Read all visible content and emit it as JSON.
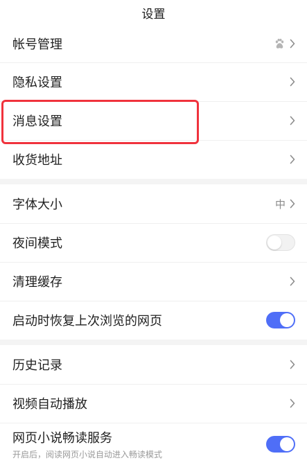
{
  "header": {
    "title": "设置"
  },
  "colors": {
    "accent": "#4f6ef7",
    "highlight": "#f0323c",
    "divider": "#efefef",
    "section_gap": "#f4f4f4"
  },
  "group1": {
    "account": {
      "label": "帐号管理",
      "icon": "baidu-paw-icon"
    },
    "privacy": {
      "label": "隐私设置"
    },
    "message": {
      "label": "消息设置"
    },
    "address": {
      "label": "收货地址"
    }
  },
  "group2": {
    "font_size": {
      "label": "字体大小",
      "value": "中"
    },
    "night_mode": {
      "label": "夜间模式",
      "enabled": false
    },
    "clear_cache": {
      "label": "清理缓存"
    },
    "restore_pages": {
      "label": "启动时恢复上次浏览的网页",
      "enabled": true
    }
  },
  "group3": {
    "history": {
      "label": "历史记录"
    },
    "video_autoplay": {
      "label": "视频自动播放"
    },
    "novel_reader": {
      "label": "网页小说畅读服务",
      "subtitle": "开启后，阅读网页小说自动进入畅读模式",
      "enabled": true
    }
  }
}
